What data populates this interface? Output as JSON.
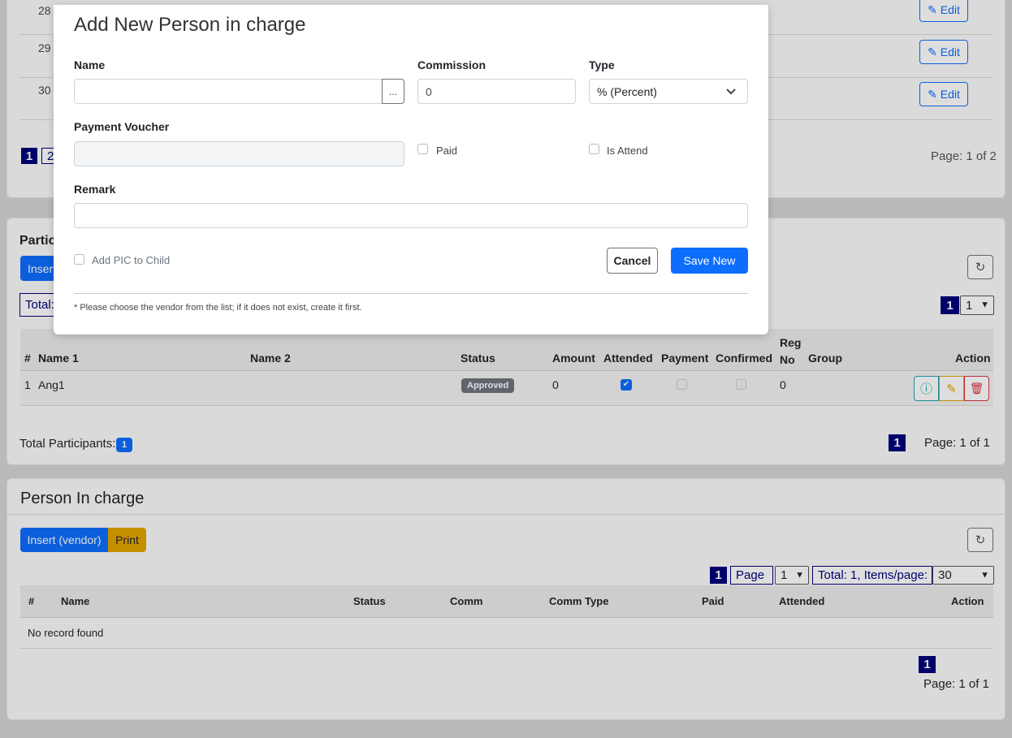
{
  "top_table": {
    "rows": [
      {
        "num": "28",
        "edit_label": "Edit"
      },
      {
        "num": "29",
        "edit_label": "Edit"
      },
      {
        "num": "30",
        "edit_label": "Edit"
      }
    ],
    "pager": {
      "active": "1",
      "next": "2"
    },
    "page_info": "Page: 1 of 2"
  },
  "participants": {
    "title": "Partic",
    "insert_label": "Insert",
    "total_label": "Total:",
    "page_active": "1",
    "page_select": "1",
    "headers": [
      "#",
      "Name 1",
      "Name 2",
      "Status",
      "Amount",
      "Attended",
      "Payment",
      "Confirmed",
      "Reg No",
      "Group",
      "Action"
    ],
    "rows": [
      {
        "num": "1",
        "name1": "Ang1",
        "name2": "",
        "status": "Approved",
        "amount": "0",
        "attended": true,
        "payment": false,
        "confirmed": false,
        "reg_no": "0",
        "group": ""
      }
    ],
    "total_participants_label": "Total Participants:",
    "total_participants": "1",
    "footer_page_active": "1",
    "page_info": "Page: 1 of 1"
  },
  "pic_section": {
    "title": "Person In charge",
    "insert_label": "Insert (vendor)",
    "print_label": "Print",
    "pager": {
      "active": "1",
      "page_label": "Page",
      "page_select": "1",
      "items_label": "Total: 1, Items/page:",
      "items_select": "30"
    },
    "headers": [
      "#",
      "Name",
      "Status",
      "Comm",
      "Comm Type",
      "Paid",
      "Attended",
      "Action"
    ],
    "empty_text": "No record found",
    "footer_page_active": "1",
    "page_info": "Page: 1 of 1"
  },
  "modal": {
    "title": "Add New Person in charge",
    "name_label": "Name",
    "name_value": "",
    "browse_label": "...",
    "commission_label": "Commission",
    "commission_value": "0",
    "type_label": "Type",
    "type_value": "% (Percent)",
    "voucher_label": "Payment Voucher",
    "voucher_value": "",
    "paid_label": "Paid",
    "is_attend_label": "Is Attend",
    "remark_label": "Remark",
    "remark_value": "",
    "add_pic_child_label": "Add PIC to Child",
    "cancel_label": "Cancel",
    "save_label": "Save New",
    "footnote": "* Please choose the vendor from the list; if it does not exist, create it first."
  },
  "colors": {
    "primary": "#0d6efd",
    "pager_navy": "#00007a",
    "warning": "#e4a500",
    "info": "#17a2b8",
    "danger": "#dc3545",
    "badge_secondary": "#6c757d"
  }
}
